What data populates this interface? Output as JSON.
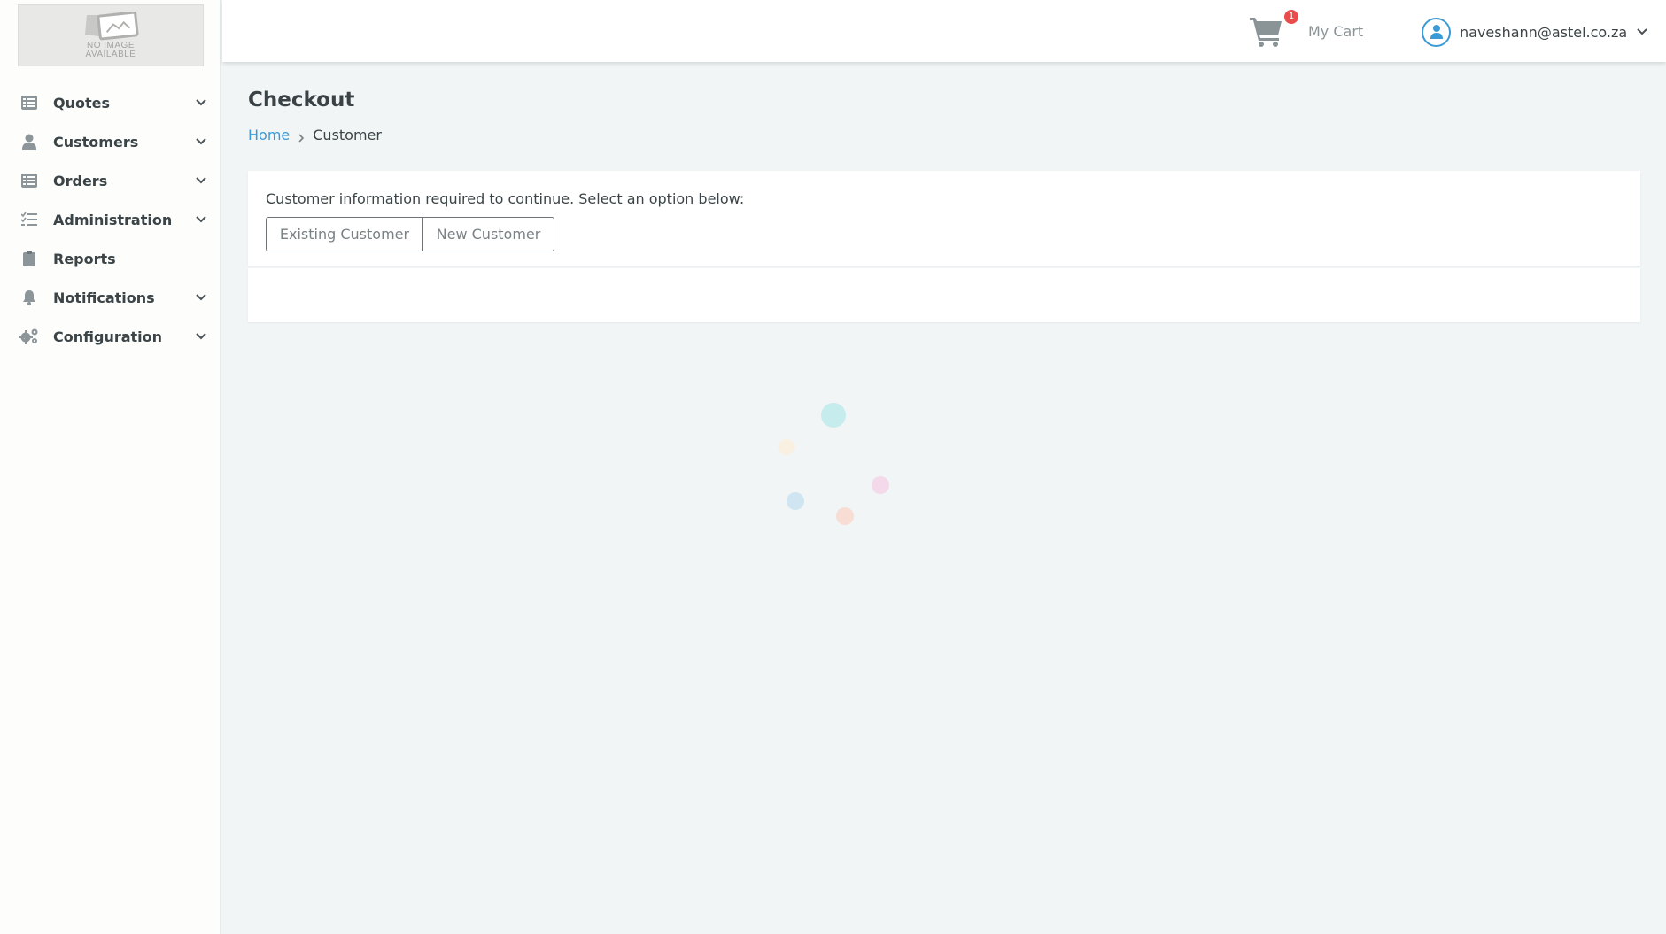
{
  "logo": {
    "text_line1": "NO IMAGE",
    "text_line2": "AVAILABLE"
  },
  "sidebar": {
    "items": [
      {
        "label": "Quotes",
        "icon": "list-icon",
        "has_chevron": true
      },
      {
        "label": "Customers",
        "icon": "user-icon",
        "has_chevron": true
      },
      {
        "label": "Orders",
        "icon": "list-icon",
        "has_chevron": true
      },
      {
        "label": "Administration",
        "icon": "checklist-icon",
        "has_chevron": true
      },
      {
        "label": "Reports",
        "icon": "clipboard-icon",
        "has_chevron": false
      },
      {
        "label": "Notifications",
        "icon": "bell-icon",
        "has_chevron": true
      },
      {
        "label": "Configuration",
        "icon": "gears-icon",
        "has_chevron": true
      }
    ]
  },
  "header": {
    "cart_badge": "1",
    "cart_label": "My Cart",
    "user_email": "naveshann@astel.co.za"
  },
  "page": {
    "title": "Checkout",
    "breadcrumb": {
      "home": "Home",
      "current": "Customer"
    }
  },
  "customer_card": {
    "prompt": "Customer information required to continue. Select an option below:",
    "existing_label": "Existing Customer",
    "new_label": "New Customer"
  },
  "colors": {
    "accent": "#3a9ad9",
    "badge": "#ea4c4c",
    "background": "#f1f5f5",
    "sidebar": "#fdfdfc"
  }
}
